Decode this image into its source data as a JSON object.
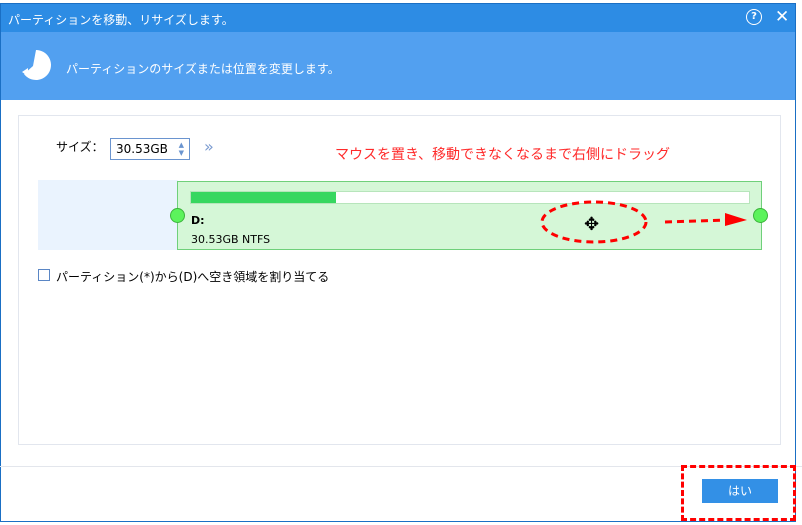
{
  "window": {
    "title": "パーティションを移動、リサイズします。",
    "help_icon": "help-icon",
    "close_icon": "close-icon"
  },
  "header": {
    "text": "パーティションのサイズまたは位置を変更します。",
    "icon": "partition-move-icon"
  },
  "size": {
    "label": "サイズ：",
    "value": "30.53GB"
  },
  "annotation": {
    "hint": "マウスを置き、移動できなくなるまで右側にドラッグ",
    "color": "#ff0000"
  },
  "partition": {
    "letter": "D:",
    "info": "30.53GB NTFS",
    "used_fraction": 0.26
  },
  "checkbox": {
    "label": "パーティション(*)から(D)へ空き領域を割り当てる",
    "checked": false
  },
  "footer": {
    "ok_label": "はい"
  },
  "colors": {
    "title": "#2d8ce4",
    "header": "#52a0f0",
    "partition": "#d5f7d7",
    "used": "#37d760"
  }
}
